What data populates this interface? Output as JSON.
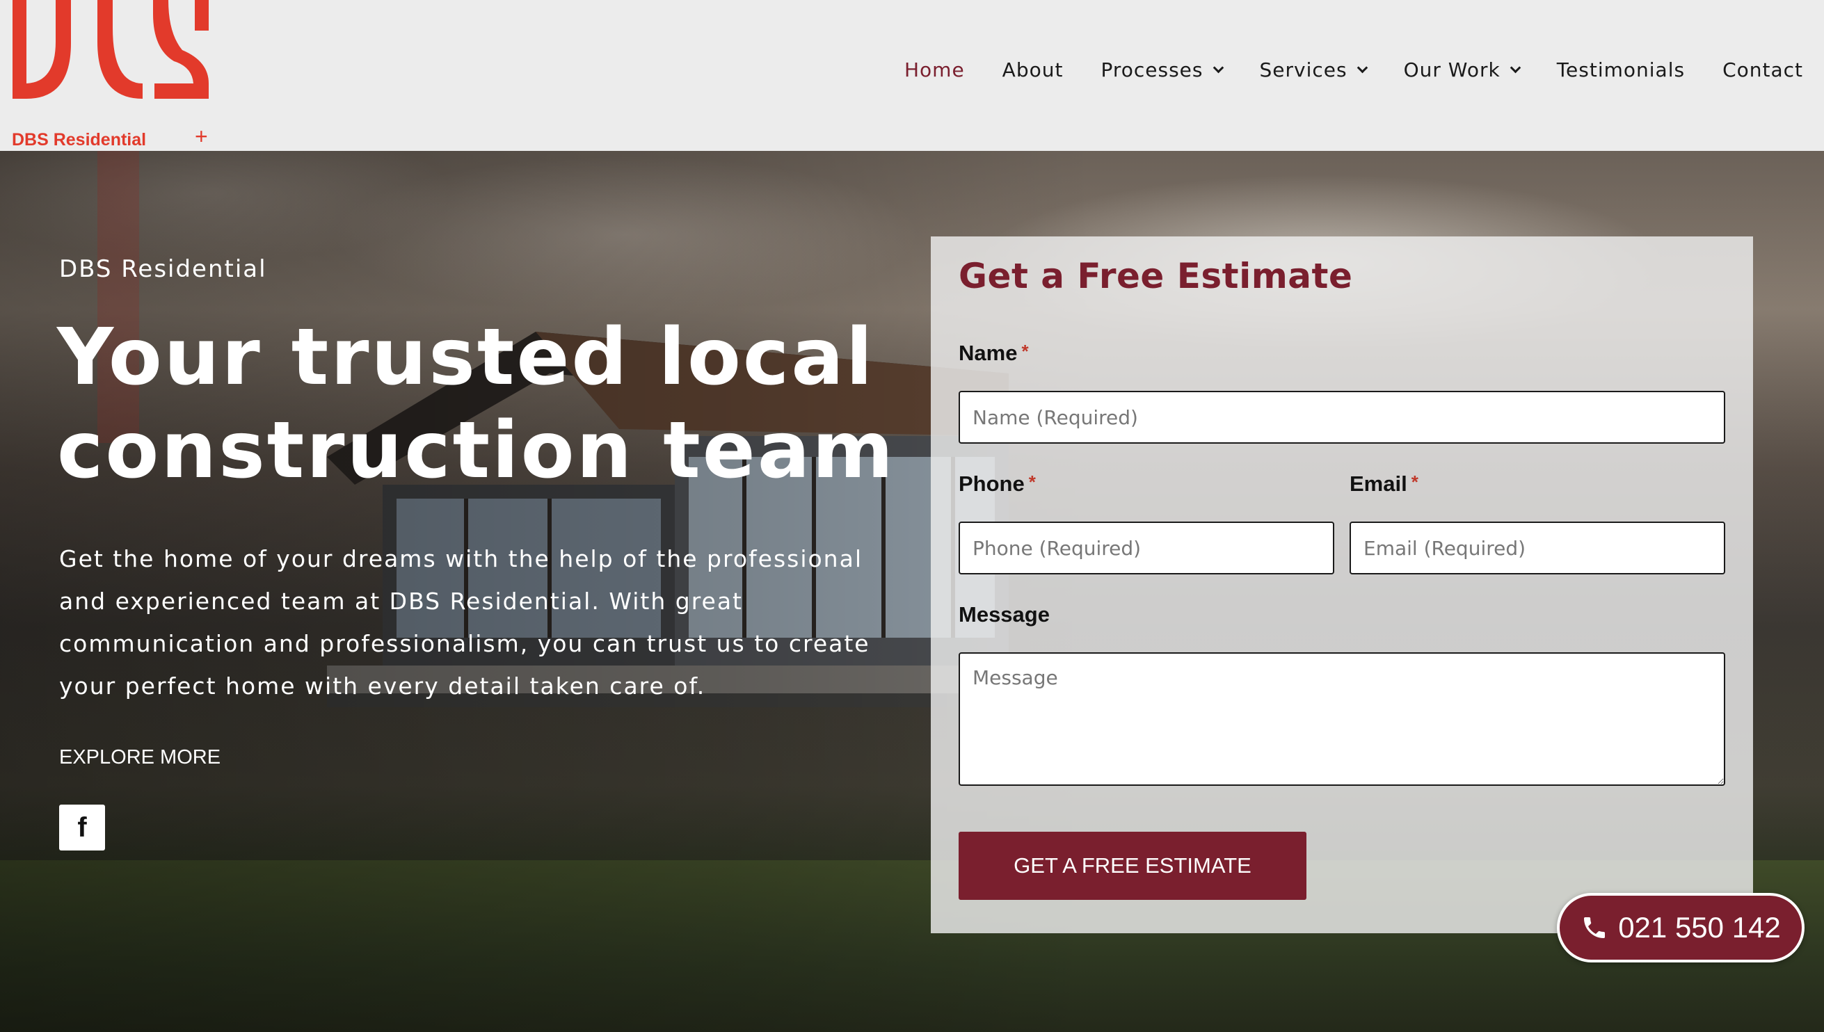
{
  "brand": {
    "name": "DBS Residential",
    "accent": "#e23a2b",
    "primary": "#7a1f2e"
  },
  "nav": {
    "items": [
      {
        "label": "Home",
        "active": true,
        "dropdown": false
      },
      {
        "label": "About",
        "active": false,
        "dropdown": false
      },
      {
        "label": "Processes",
        "active": false,
        "dropdown": true
      },
      {
        "label": "Services",
        "active": false,
        "dropdown": true
      },
      {
        "label": "Our Work",
        "active": false,
        "dropdown": true
      },
      {
        "label": "Testimonials",
        "active": false,
        "dropdown": false
      },
      {
        "label": "Contact",
        "active": false,
        "dropdown": false
      }
    ]
  },
  "hero": {
    "eyebrow": "DBS Residential",
    "headline": "Your trusted local construction team",
    "intro": "Get the home of your dreams with the help of the professional and experienced team at DBS Residential. With great communication and professionalism, you can trust us to create your perfect home with every detail taken care of.",
    "explore_label": "EXPLORE MORE",
    "social_icon": "facebook-icon"
  },
  "form": {
    "title": "Get a Free Estimate",
    "name_label": "Name",
    "name_placeholder": "Name (Required)",
    "phone_label": "Phone",
    "phone_placeholder": "Phone (Required)",
    "email_label": "Email",
    "email_placeholder": "Email (Required)",
    "message_label": "Message",
    "message_placeholder": "Message",
    "required_marker": "*",
    "submit_label": "GET A FREE ESTIMATE"
  },
  "floating_phone": {
    "icon": "phone-icon",
    "number": "021 550 142"
  }
}
